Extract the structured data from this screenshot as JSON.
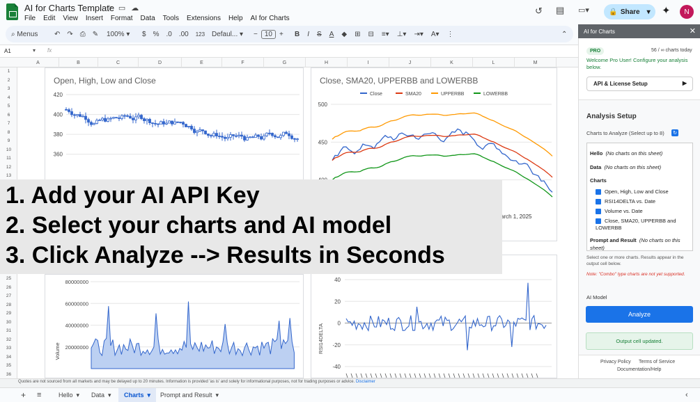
{
  "app": {
    "title": "AI for Charts Template",
    "name_box": "A1",
    "fx": "fx",
    "avatar": "N",
    "share": "Share"
  },
  "menu": [
    "File",
    "Edit",
    "View",
    "Insert",
    "Format",
    "Data",
    "Tools",
    "Extensions",
    "Help",
    "AI for Charts"
  ],
  "toolbar": {
    "search": "Menus",
    "zoom": "100%",
    "currency": "$",
    "percent": "%",
    "dec1": ".0",
    "dec2": ".00",
    "num": "123",
    "font": "Defaul...",
    "font_size": "10",
    "bold": "B",
    "italic": "I"
  },
  "columns": [
    "A",
    "B",
    "C",
    "D",
    "E",
    "F",
    "G",
    "H",
    "I",
    "J",
    "K",
    "L",
    "M"
  ],
  "rows": [
    "1",
    "2",
    "3",
    "4",
    "5",
    "6",
    "7",
    "8",
    "9",
    "10",
    "11",
    "12",
    "13",
    "25",
    "26",
    "27",
    "28",
    "29",
    "30",
    "31",
    "32",
    "33",
    "34",
    "35",
    "36"
  ],
  "overlay": {
    "line1": "1. Add your AI API Key",
    "line2": "2. Select your charts and AI model",
    "line3": "3. Click Analyze --> Results in Seconds"
  },
  "charts": {
    "ohlc": {
      "title": "Open, High, Low and Close"
    },
    "bb": {
      "title": "Close, SMA20, UPPERBB and LOWERBB",
      "date_label": "arch 1, 2025"
    },
    "volume": {
      "ylabel": "Volume"
    },
    "rsi": {
      "ylabel": "RSI14DELTA"
    }
  },
  "chart_data": [
    {
      "type": "line",
      "title": "Open, High, Low and Close",
      "yticks": [
        "420",
        "400",
        "380",
        "360"
      ],
      "ylim": [
        350,
        420
      ]
    },
    {
      "type": "line",
      "title": "Close, SMA20, UPPERBB and LOWERBB",
      "series": [
        {
          "name": "Close",
          "color": "#3366cc"
        },
        {
          "name": "SMA20",
          "color": "#dc3912"
        },
        {
          "name": "UPPERBB",
          "color": "#ff9900"
        },
        {
          "name": "LOWERBB",
          "color": "#109618"
        }
      ],
      "yticks": [
        "500",
        "450",
        "400"
      ],
      "ylim": [
        350,
        500
      ]
    },
    {
      "type": "area",
      "ylabel": "Volume",
      "yticks": [
        "80000000",
        "60000000",
        "40000000",
        "20000000"
      ],
      "ylim": [
        0,
        80000000
      ]
    },
    {
      "type": "line",
      "ylabel": "RSI14DELTA",
      "yticks": [
        "40",
        "20",
        "0",
        "-20",
        "-40"
      ],
      "ylim": [
        -40,
        40
      ]
    }
  ],
  "sidebar": {
    "header": "AI for Charts",
    "badge": "PRO",
    "count": "56 / ∞ charts today",
    "welcome": "Welcome Pro User! Configure your analysis below.",
    "api_setup": "API & License Setup",
    "analysis_setup": "Analysis Setup",
    "select_label": "Charts to Analyze (Select up to 8)",
    "hello": "Hello",
    "hello_note": "(No charts on this sheet)",
    "data": "Data",
    "data_note": "(No charts on this sheet)",
    "charts": "Charts",
    "items": [
      "Open, High, Low and Close",
      "RSI14DELTA vs. Date",
      "Volume vs. Date",
      "Close, SMA20, UPPERBB and LOWERBB"
    ],
    "prompt": "Prompt and Result",
    "prompt_note": "(No charts on this sheet)",
    "help": "Select one or more charts. Results appear in the output cell below.",
    "note": "Note: \"Combo\" type charts are not yet supported.",
    "ai_model": "AI Model",
    "analyze": "Analyze",
    "status": "Output cell updated.",
    "privacy": "Privacy Policy",
    "terms": "Terms of Service",
    "docs": "Documentation/Help"
  },
  "footer": {
    "disclaimer": "Quotes are not sourced from all markets and may be delayed up to 20 minutes. Information is provided 'as is' and solely for informational purposes, not for trading purposes or advice.",
    "disclaimer_link": "Disclaimer"
  },
  "tabs": [
    "Hello",
    "Data",
    "Charts",
    "Prompt and Result"
  ]
}
